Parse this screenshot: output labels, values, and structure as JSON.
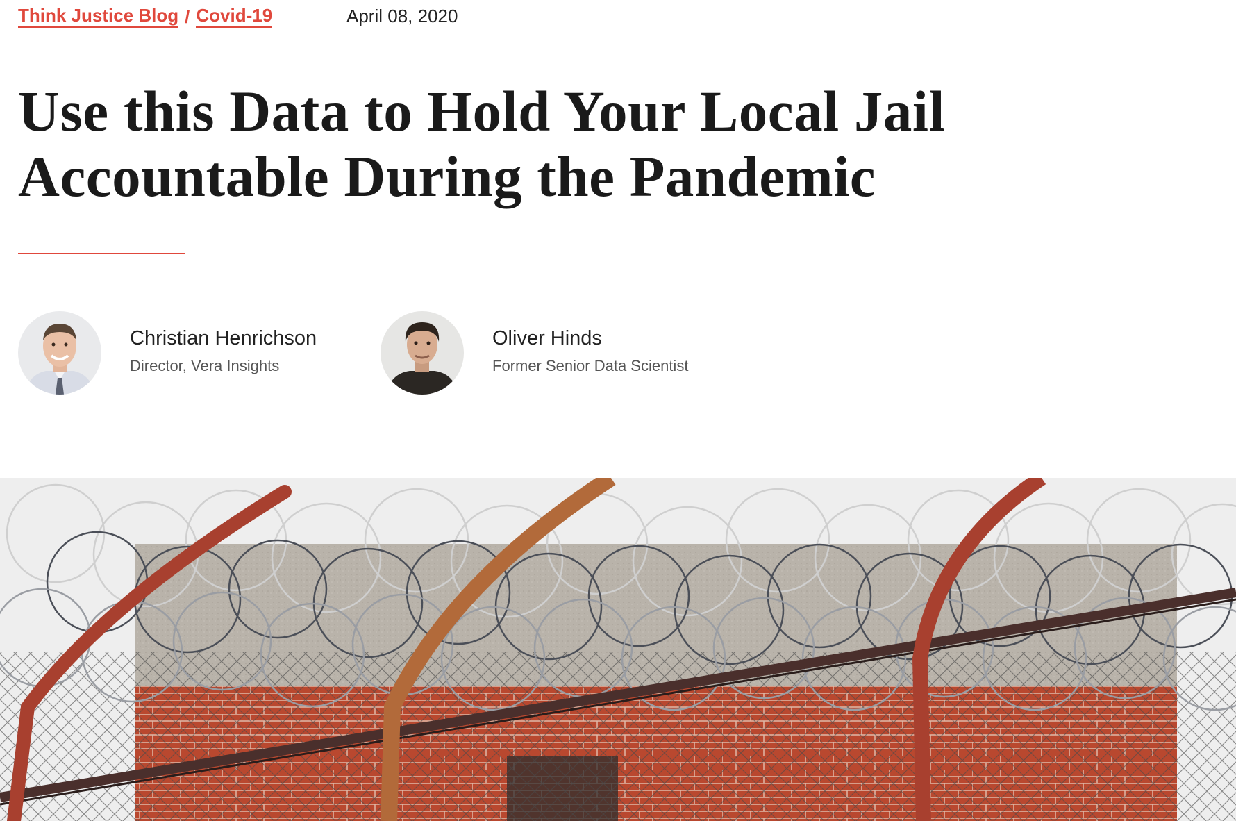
{
  "breadcrumb": {
    "blog_label": "Think Justice Blog",
    "separator": "/",
    "topic_label": "Covid-19"
  },
  "date": "April 08, 2020",
  "title_line1": "Use this Data to Hold Your Local Jail",
  "title_line2": "Accountable During the Pandemic",
  "authors": [
    {
      "name": "Christian Henrichson",
      "role": "Director, Vera Insights"
    },
    {
      "name": "Oliver Hinds",
      "role": "Former Senior Data Scientist"
    }
  ],
  "colors": {
    "accent": "#e0483c",
    "text": "#1a1a1a"
  }
}
